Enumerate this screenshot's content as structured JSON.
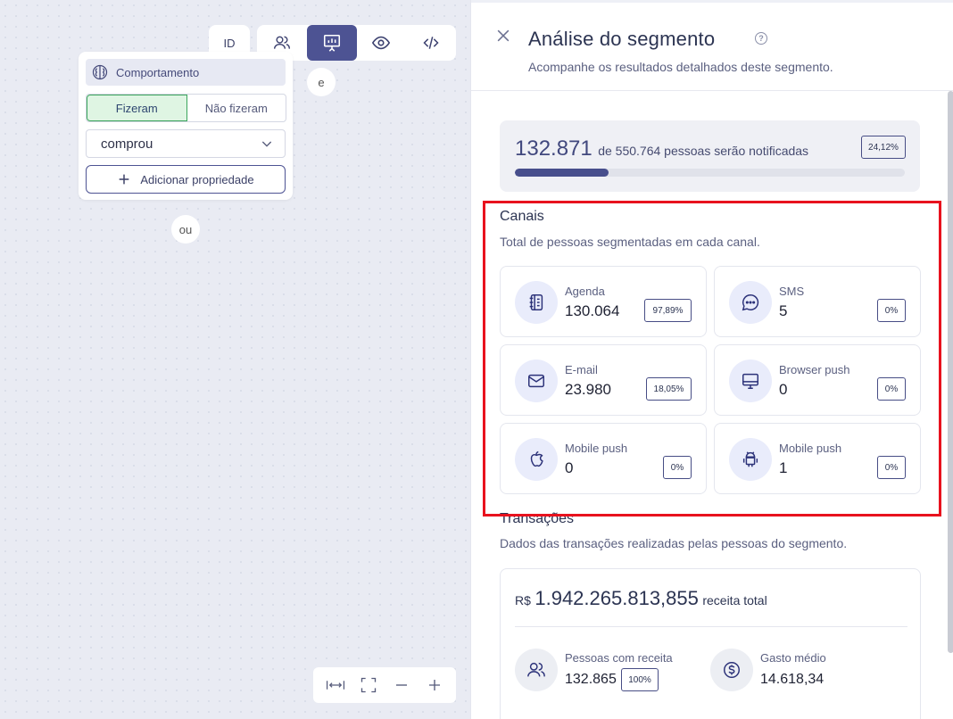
{
  "toolbar": {
    "id_label": "ID"
  },
  "node": {
    "header_label": "Comportamento",
    "toggle_on": "Fizeram",
    "toggle_off": "Não fizeram",
    "select_value": "comprou",
    "add_property_label": "Adicionar propriedade"
  },
  "connectors": {
    "and_label": "e",
    "or_label": "ou"
  },
  "panel": {
    "title": "Análise do segmento",
    "subtitle": "Acompanhe os resultados detalhados deste segmento.",
    "summary": {
      "count": "132.871",
      "rest": "de 550.764 pessoas serão notificadas",
      "percent_label": "24,12%",
      "progress": 0.2412
    },
    "channels": {
      "title": "Canais",
      "subtitle": "Total de pessoas segmentadas em cada canal.",
      "items": [
        {
          "label": "Agenda",
          "value": "130.064",
          "percent": "97,89%",
          "icon": "address-book-icon"
        },
        {
          "label": "SMS",
          "value": "5",
          "percent": "0%",
          "icon": "chat-bubble-icon"
        },
        {
          "label": "E-mail",
          "value": "23.980",
          "percent": "18,05%",
          "icon": "envelope-icon"
        },
        {
          "label": "Browser push",
          "value": "0",
          "percent": "0%",
          "icon": "desktop-icon"
        },
        {
          "label": "Mobile push",
          "value": "0",
          "percent": "0%",
          "icon": "apple-icon"
        },
        {
          "label": "Mobile push",
          "value": "1",
          "percent": "0%",
          "icon": "android-icon"
        }
      ]
    },
    "transactions": {
      "title": "Transações",
      "subtitle": "Dados das transações realizadas pelas pessoas do segmento.",
      "currency": "R$",
      "total": "1.942.265.813,855",
      "total_label": "receita total",
      "people_label": "Pessoas com receita",
      "people_value": "132.865",
      "people_percent": "100%",
      "avg_label": "Gasto médio",
      "avg_value": "14.618,34"
    }
  },
  "colors": {
    "accent": "#4d5393",
    "highlight_border": "#e8121e",
    "active_toggle": "#dff5e3"
  }
}
